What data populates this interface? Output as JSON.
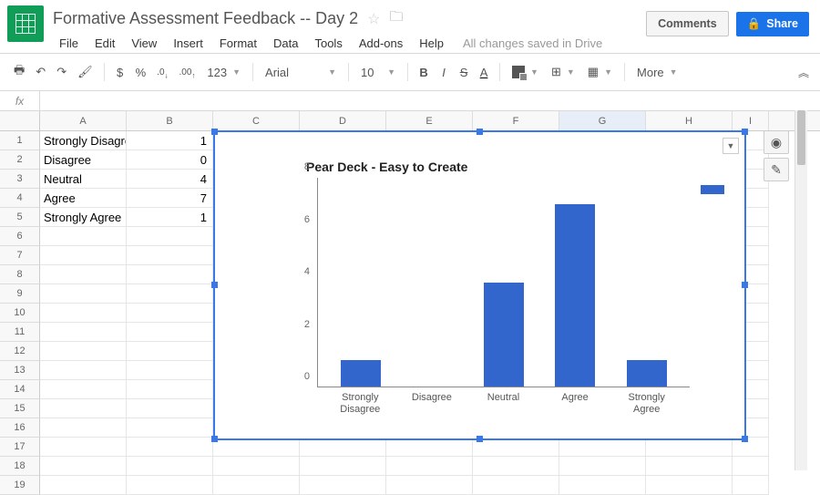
{
  "doc": {
    "title": "Formative Assessment Feedback -- Day 2"
  },
  "menu": {
    "file": "File",
    "edit": "Edit",
    "view": "View",
    "insert": "Insert",
    "format": "Format",
    "data": "Data",
    "tools": "Tools",
    "addons": "Add-ons",
    "help": "Help"
  },
  "status": "All changes saved in Drive",
  "buttons": {
    "comments": "Comments",
    "share": "Share"
  },
  "toolbar": {
    "currency": "$",
    "percent": "%",
    "dec_dec": ".0",
    "dec_inc": ".00",
    "numfmt": "123",
    "font": "Arial",
    "size": "10",
    "bold": "B",
    "italic": "I",
    "strike": "S",
    "textcolor": "A",
    "more": "More"
  },
  "fx": {
    "label": "fx",
    "value": ""
  },
  "columns": [
    "A",
    "B",
    "C",
    "D",
    "E",
    "F",
    "G",
    "H",
    "I"
  ],
  "row_numbers": [
    "1",
    "2",
    "3",
    "4",
    "5",
    "6",
    "7",
    "8",
    "9",
    "10",
    "11",
    "12",
    "13",
    "14",
    "15",
    "16",
    "17",
    "18",
    "19"
  ],
  "cells": {
    "a": [
      "Strongly Disagre",
      "Disagree",
      "Neutral",
      "Agree",
      "Strongly Agree"
    ],
    "b": [
      "1",
      "0",
      "4",
      "7",
      "1"
    ]
  },
  "chart_data": {
    "type": "bar",
    "title": "Pear Deck - Easy to Create",
    "categories": [
      "Strongly Disagree",
      "Disagree",
      "Neutral",
      "Agree",
      "Strongly Agree"
    ],
    "values": [
      1,
      0,
      4,
      7,
      1
    ],
    "ylim": [
      0,
      8
    ],
    "yticks": [
      0,
      2,
      4,
      6,
      8
    ],
    "xlabel": "",
    "ylabel": ""
  }
}
